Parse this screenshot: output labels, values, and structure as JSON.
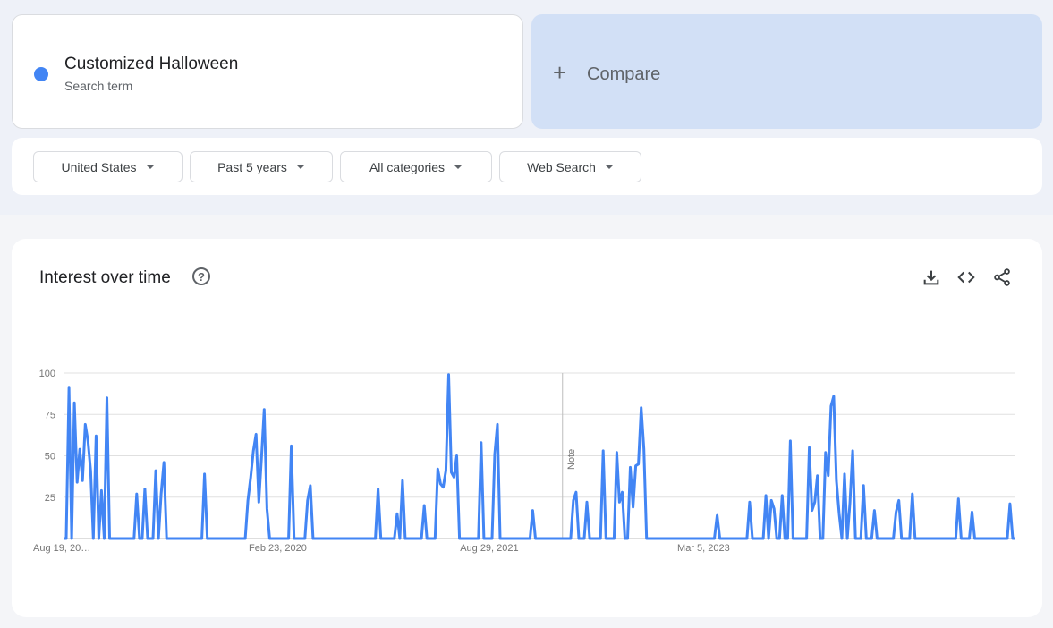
{
  "search": {
    "term": "Customized Halloween",
    "subtitle": "Search term",
    "color": "#4285f4",
    "compare_label": "Compare"
  },
  "filters": {
    "region": "United States",
    "period": "Past 5 years",
    "category": "All categories",
    "property": "Web Search"
  },
  "interest": {
    "title": "Interest over time",
    "help_icon": "help-circle-icon",
    "tools": [
      "download-icon",
      "embed-code-icon",
      "share-icon"
    ],
    "note_label": "Note"
  },
  "chart_data": {
    "type": "line",
    "title": "",
    "xlabel": "",
    "ylabel": "",
    "ylim": [
      0,
      100
    ],
    "grid": true,
    "y_ticks": [
      100,
      75,
      50,
      25
    ],
    "x_tick_labels": [
      "Aug 19, 20…",
      "Feb 23, 2020",
      "Aug 29, 2021",
      "Mar 5, 2023"
    ],
    "x_tick_weeks": [
      0,
      79,
      157,
      236
    ],
    "note_week": 184,
    "series": [
      {
        "color": "#4285f4",
        "values": [
          0,
          0,
          91,
          0,
          82,
          34,
          54,
          35,
          69,
          59,
          41,
          0,
          62,
          0,
          29,
          0,
          85,
          0,
          0,
          0,
          0,
          0,
          0,
          0,
          0,
          0,
          0,
          27,
          0,
          0,
          30,
          0,
          0,
          0,
          41,
          0,
          27,
          46,
          0,
          0,
          0,
          0,
          0,
          0,
          0,
          0,
          0,
          0,
          0,
          0,
          0,
          0,
          39,
          0,
          0,
          0,
          0,
          0,
          0,
          0,
          0,
          0,
          0,
          0,
          0,
          0,
          0,
          0,
          23,
          37,
          53,
          63,
          22,
          49,
          78,
          18,
          0,
          0,
          0,
          0,
          0,
          0,
          0,
          0,
          56,
          0,
          0,
          0,
          0,
          0,
          23,
          32,
          0,
          0,
          0,
          0,
          0,
          0,
          0,
          0,
          0,
          0,
          0,
          0,
          0,
          0,
          0,
          0,
          0,
          0,
          0,
          0,
          0,
          0,
          0,
          0,
          30,
          0,
          0,
          0,
          0,
          0,
          0,
          15,
          0,
          35,
          0,
          0,
          0,
          0,
          0,
          0,
          0,
          20,
          0,
          0,
          0,
          0,
          42,
          33,
          31,
          41,
          99,
          40,
          37,
          50,
          0,
          0,
          0,
          0,
          0,
          0,
          0,
          0,
          58,
          0,
          0,
          0,
          0,
          51,
          69,
          0,
          0,
          0,
          0,
          0,
          0,
          0,
          0,
          0,
          0,
          0,
          0,
          17,
          0,
          0,
          0,
          0,
          0,
          0,
          0,
          0,
          0,
          0,
          0,
          0,
          0,
          0,
          23,
          28,
          0,
          0,
          0,
          22,
          0,
          0,
          0,
          0,
          0,
          53,
          0,
          0,
          0,
          0,
          52,
          22,
          28,
          0,
          0,
          43,
          19,
          44,
          45,
          79,
          54,
          0,
          0,
          0,
          0,
          0,
          0,
          0,
          0,
          0,
          0,
          0,
          0,
          0,
          0,
          0,
          0,
          0,
          0,
          0,
          0,
          0,
          0,
          0,
          0,
          0,
          0,
          14,
          0,
          0,
          0,
          0,
          0,
          0,
          0,
          0,
          0,
          0,
          0,
          22,
          0,
          0,
          0,
          0,
          0,
          26,
          0,
          23,
          18,
          0,
          0,
          26,
          0,
          0,
          59,
          0,
          0,
          0,
          0,
          0,
          0,
          55,
          17,
          22,
          38,
          0,
          0,
          52,
          38,
          80,
          86,
          35,
          15,
          0,
          39,
          0,
          22,
          53,
          0,
          0,
          0,
          32,
          0,
          0,
          0,
          17,
          0,
          0,
          0,
          0,
          0,
          0,
          0,
          16,
          23,
          0,
          0,
          0,
          0,
          27,
          0,
          0,
          0,
          0,
          0,
          0,
          0,
          0,
          0,
          0,
          0,
          0,
          0,
          0,
          0,
          0,
          24,
          0,
          0,
          0,
          0,
          16,
          0,
          0,
          0,
          0,
          0,
          0,
          0,
          0,
          0,
          0,
          0,
          0,
          0,
          21,
          0,
          0
        ]
      }
    ]
  }
}
